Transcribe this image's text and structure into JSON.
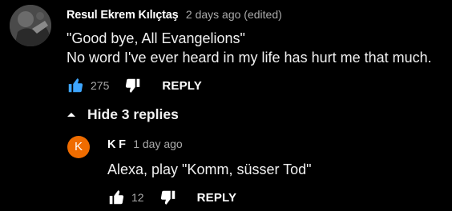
{
  "comment": {
    "author": "Resul Ekrem Kılıçtaş",
    "timestamp": "2 days ago (edited)",
    "text_lines": [
      "\"Good bye, All Evangelions\"",
      "No word I've ever heard in my life has hurt me that much."
    ],
    "likes": "275",
    "reply_label": "REPLY",
    "liked": true
  },
  "replies_toggle": {
    "label": "Hide 3 replies"
  },
  "reply": {
    "avatar_letter": "K",
    "author": "K F",
    "timestamp": "1 day ago",
    "text": "Alexa, play \"Komm, süsser Tod\"",
    "likes": "12",
    "reply_label": "REPLY"
  },
  "colors": {
    "background": "#000000",
    "liked_blue": "#3ea6ff",
    "muted_text": "#aaaaaa",
    "reply_avatar": "#ef6c00"
  }
}
